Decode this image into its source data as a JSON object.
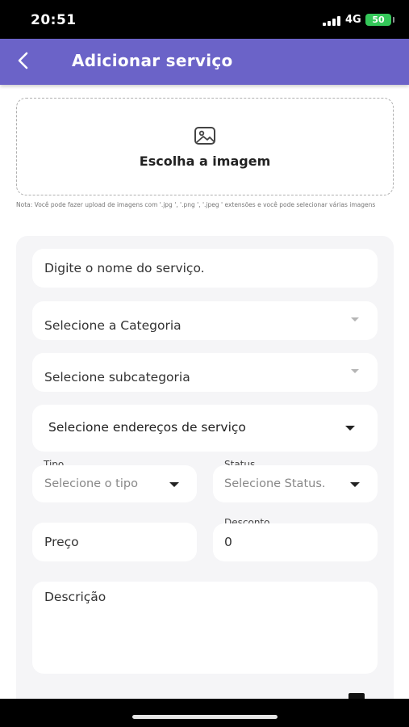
{
  "status_bar": {
    "time": "20:51",
    "network": "4G",
    "battery": "50"
  },
  "app_bar": {
    "title": "Adicionar serviço"
  },
  "image_picker": {
    "label": "Escolha a imagem",
    "note": "Nota: Você pode fazer upload de imagens com '.jpg ', '.png ', '.jpeg ' extensões e você pode selecionar várias imagens"
  },
  "form": {
    "service_name_placeholder": "Digite o nome do serviço.",
    "category_placeholder": "Selecione a Categoria",
    "subcategory_placeholder": "Selecione subcategoria",
    "service_address_placeholder": "Selecione endereços de serviço",
    "type_label": "Tipo",
    "type_placeholder": "Selecione o tipo",
    "status_label": "Status",
    "status_placeholder": "Selecione Status.",
    "price_placeholder": "Preço",
    "discount_label": "Desconto",
    "discount_value": "0",
    "description_placeholder": "Descrição"
  },
  "colors": {
    "app_bar": "#6b63c8",
    "battery": "#34c759",
    "form_background": "#f5f5f7"
  }
}
